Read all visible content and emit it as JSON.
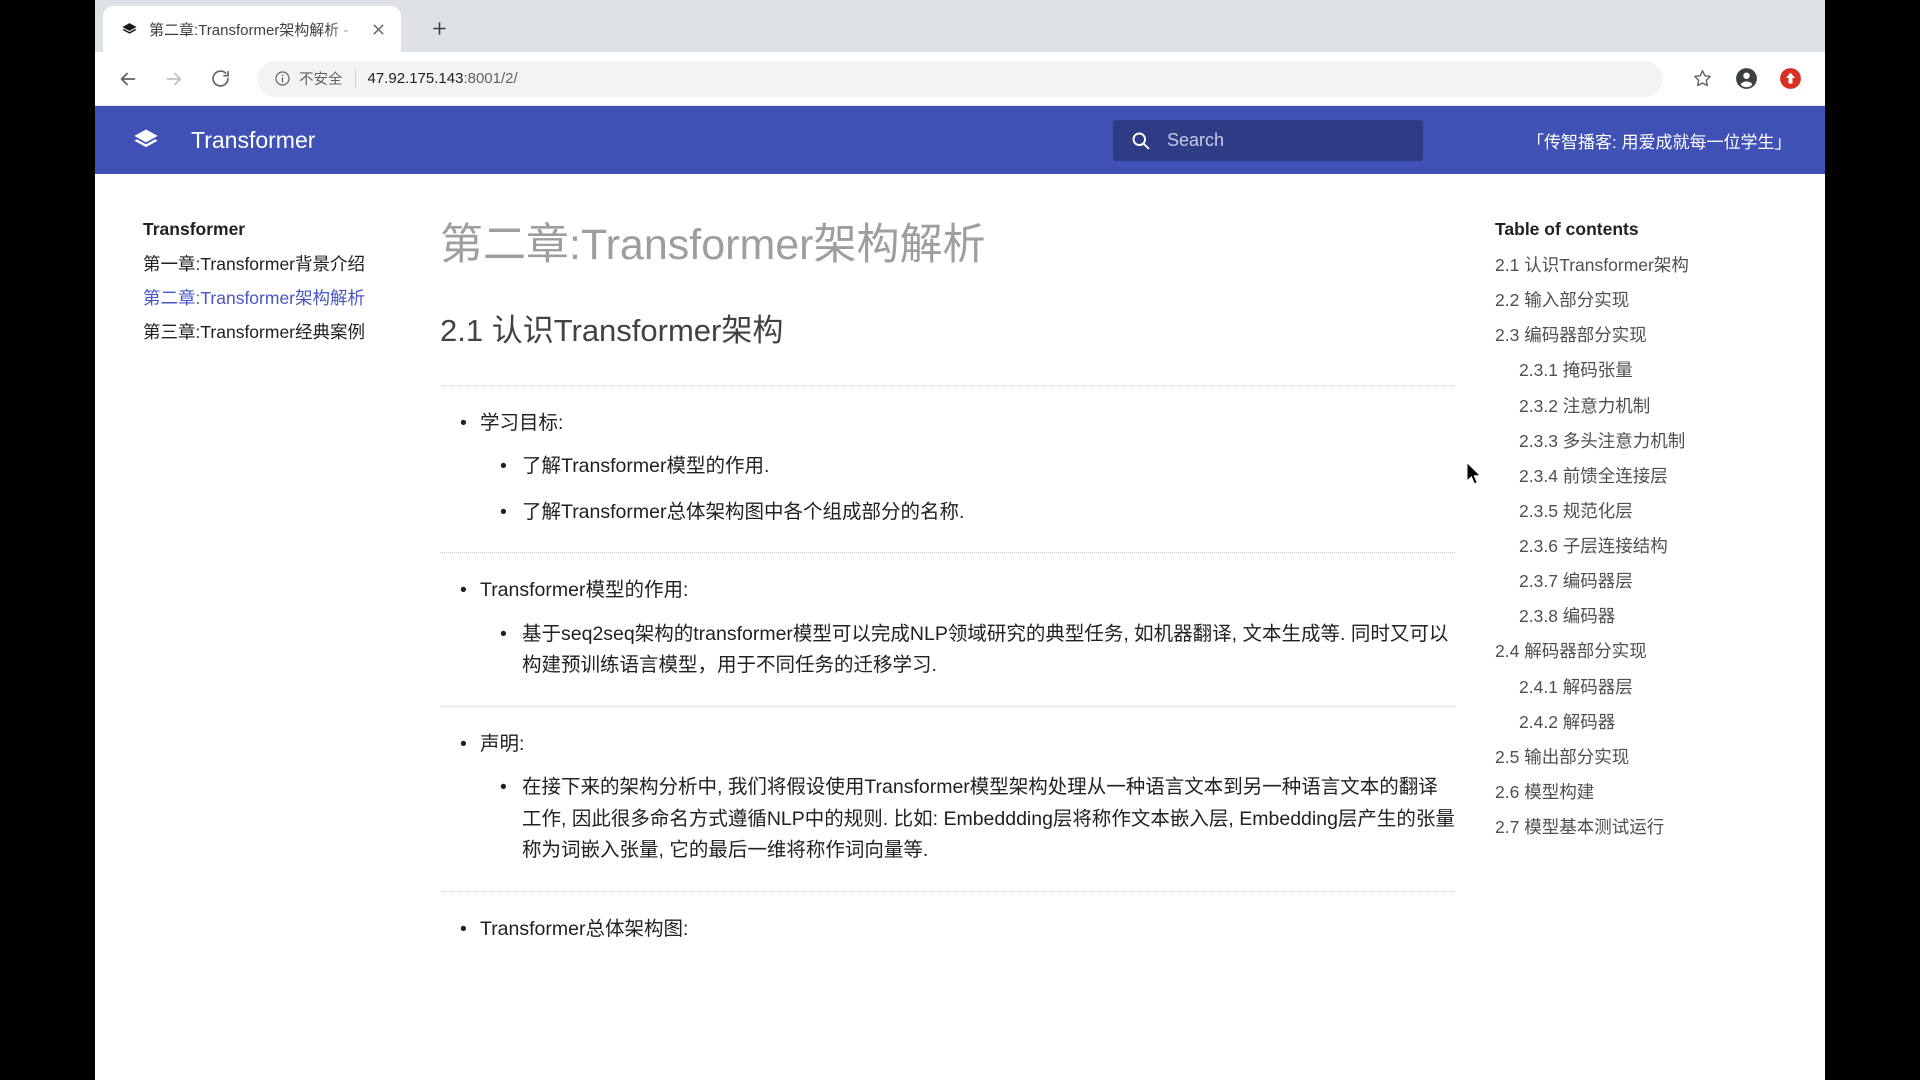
{
  "browser": {
    "tab": {
      "favicon_icon": "mkdocs-layers-icon",
      "title": "第二章:Transformer架构解析 -",
      "close_icon": "close-icon"
    },
    "new_tab_icon": "plus-icon",
    "back_icon": "arrow-left-icon",
    "forward_icon": "arrow-right-icon",
    "reload_icon": "reload-icon",
    "omnibox": {
      "info_icon": "info-circle-icon",
      "security_label": "不安全",
      "url_host": "47.92.175.143",
      "url_path": ":8001/2/"
    },
    "bookmark_icon": "star-icon",
    "profile_icon": "account-circle-icon",
    "update_icon": "update-arrow-icon"
  },
  "site": {
    "brand_color": "#3f51b5",
    "logo_icon": "layers-icon",
    "title": "Transformer",
    "search": {
      "icon": "search-icon",
      "value": "",
      "placeholder": "Search"
    },
    "slogan": "「传智播客: 用爱成就每一位学生」"
  },
  "sidebar": {
    "heading": "Transformer",
    "items": [
      {
        "label": "第一章:Transformer背景介绍",
        "active": false
      },
      {
        "label": "第二章:Transformer架构解析",
        "active": true
      },
      {
        "label": "第三章:Transformer经典案例",
        "active": false
      }
    ]
  },
  "main": {
    "page_title": "第二章:Transformer架构解析",
    "section_title": "2.1 认识Transformer架构",
    "blocks": [
      {
        "lead": "学习目标:",
        "children": [
          "了解Transformer模型的作用.",
          "了解Transformer总体架构图中各个组成部分的名称."
        ]
      },
      {
        "lead": "Transformer模型的作用:",
        "children": [
          "基于seq2seq架构的transformer模型可以完成NLP领域研究的典型任务, 如机器翻译, 文本生成等. 同时又可以构建预训练语言模型，用于不同任务的迁移学习."
        ]
      },
      {
        "lead": "声明:",
        "children": [
          "在接下来的架构分析中, 我们将假设使用Transformer模型架构处理从一种语言文本到另一种语言文本的翻译工作, 因此很多命名方式遵循NLP中的规则. 比如: Embeddding层将称作文本嵌入层, Embedding层产生的张量称为词嵌入张量, 它的最后一维将称作词向量等."
        ]
      },
      {
        "lead": "Transformer总体架构图:",
        "children": []
      }
    ]
  },
  "toc": {
    "heading": "Table of contents",
    "items": [
      {
        "label": "2.1 认识Transformer架构",
        "depth": 1
      },
      {
        "label": "2.2 输入部分实现",
        "depth": 1
      },
      {
        "label": "2.3 编码器部分实现",
        "depth": 1
      },
      {
        "label": "2.3.1 掩码张量",
        "depth": 2
      },
      {
        "label": "2.3.2 注意力机制",
        "depth": 2
      },
      {
        "label": "2.3.3 多头注意力机制",
        "depth": 2
      },
      {
        "label": "2.3.4 前馈全连接层",
        "depth": 2
      },
      {
        "label": "2.3.5 规范化层",
        "depth": 2
      },
      {
        "label": "2.3.6 子层连接结构",
        "depth": 2
      },
      {
        "label": "2.3.7 编码器层",
        "depth": 2
      },
      {
        "label": "2.3.8 编码器",
        "depth": 2
      },
      {
        "label": "2.4 解码器部分实现",
        "depth": 1
      },
      {
        "label": "2.4.1 解码器层",
        "depth": 2
      },
      {
        "label": "2.4.2 解码器",
        "depth": 2
      },
      {
        "label": "2.5 输出部分实现",
        "depth": 1
      },
      {
        "label": "2.6 模型构建",
        "depth": 1
      },
      {
        "label": "2.7 模型基本测试运行",
        "depth": 1
      }
    ]
  }
}
